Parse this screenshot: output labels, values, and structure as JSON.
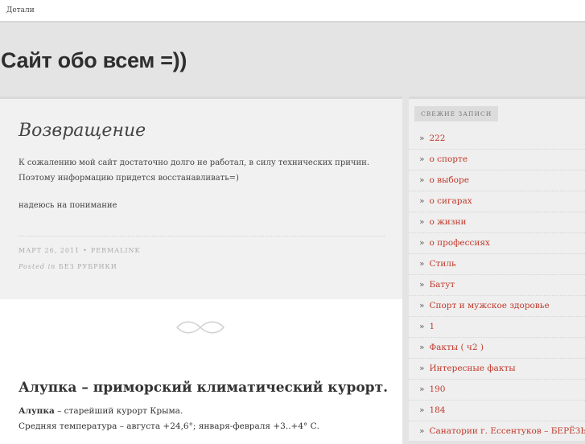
{
  "topbar": {
    "link": "Детали"
  },
  "header": {
    "site_title": "Сайт обо всем =))"
  },
  "post1": {
    "title": "Возвращение",
    "paragraph1": "К сожалению мой сайт достаточно долго не работал, в силу технических причин. Поэтому информацию придется восстанавливать=)",
    "paragraph2": "надеюсь на понимание",
    "date": "МАРТ 26, 2011",
    "bullet": "•",
    "permalink": "PERMALINK",
    "posted_in": "Posted in",
    "category": "БЕЗ РУБРИКИ"
  },
  "post2": {
    "title": "Алупка – приморский климатический курорт.",
    "line1_bold": "Алупка",
    "line1_rest": " – старейший курорт Крыма.",
    "line2": "Средняя температура – августа +24,6°; января-февраля +3..+4° С."
  },
  "sidebar": {
    "widget_title": "СВЕЖИЕ ЗАПИСИ",
    "raquo": "»",
    "items": [
      "222",
      "о спорте",
      "о выборе",
      "о сигарах",
      "о жизни",
      "о профессиях",
      "Стиль",
      "Батут",
      "Спорт и мужское здоровье",
      "1",
      "Факты ( ч2 )",
      "Интересные факты",
      "190",
      "184",
      "Санатории г. Ессентуков – БЕРЁЗЫ,"
    ]
  },
  "colors": {
    "link": "#c0392b",
    "background": "#e4e4e4",
    "post_bg": "#f1f1f1"
  }
}
